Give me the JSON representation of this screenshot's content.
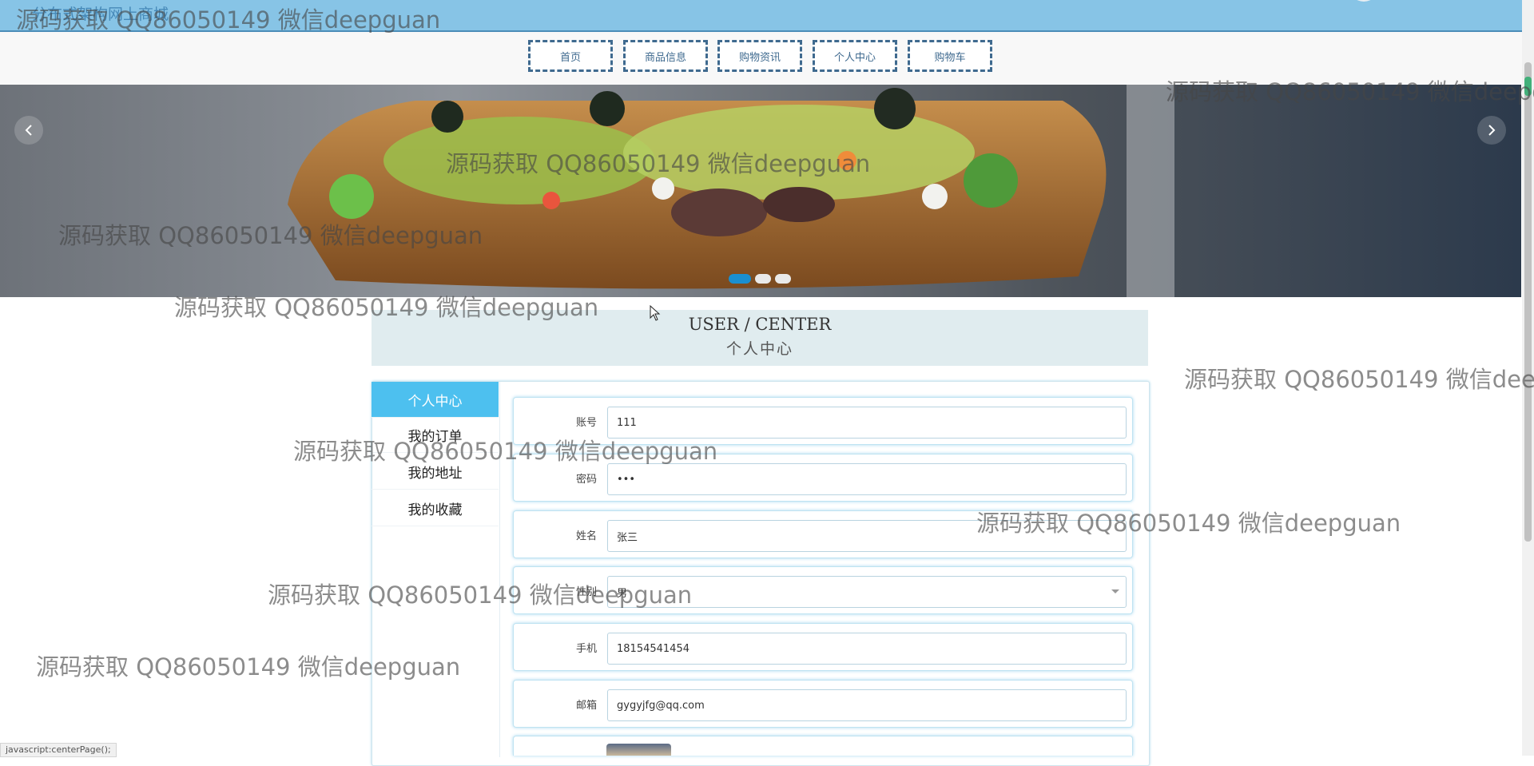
{
  "site": {
    "title": "分布式架构网上商城"
  },
  "nav": {
    "items": [
      {
        "label": "首页"
      },
      {
        "label": "商品信息"
      },
      {
        "label": "购物资讯"
      },
      {
        "label": "个人中心"
      },
      {
        "label": "购物车"
      }
    ]
  },
  "banner": {
    "prev_icon": "chevron-left-icon",
    "next_icon": "chevron-right-icon",
    "slide_count": 3,
    "active_slide": 1
  },
  "section": {
    "title_en": "USER / CENTER",
    "title_zh": "个人中心"
  },
  "sidebar": {
    "items": [
      {
        "label": "个人中心",
        "active": true
      },
      {
        "label": "我的订单"
      },
      {
        "label": "我的地址"
      },
      {
        "label": "我的收藏"
      }
    ]
  },
  "form": {
    "fields": [
      {
        "label": "账号",
        "value": "111"
      },
      {
        "label": "密码",
        "value": "•••"
      },
      {
        "label": "姓名",
        "value": "张三"
      },
      {
        "label": "性别",
        "value": "男"
      },
      {
        "label": "手机",
        "value": "18154541454"
      },
      {
        "label": "邮箱",
        "value": "gygyjfg@qq.com"
      }
    ]
  },
  "status": {
    "text": "javascript:centerPage();"
  },
  "watermark": {
    "text": "源码获取 QQ86050149 微信deepguan"
  },
  "colors": {
    "topbar": "#87c4e6",
    "accent": "#4dc0ef",
    "nav_border": "#3f6a8f",
    "section_bg": "#e0ecef"
  }
}
